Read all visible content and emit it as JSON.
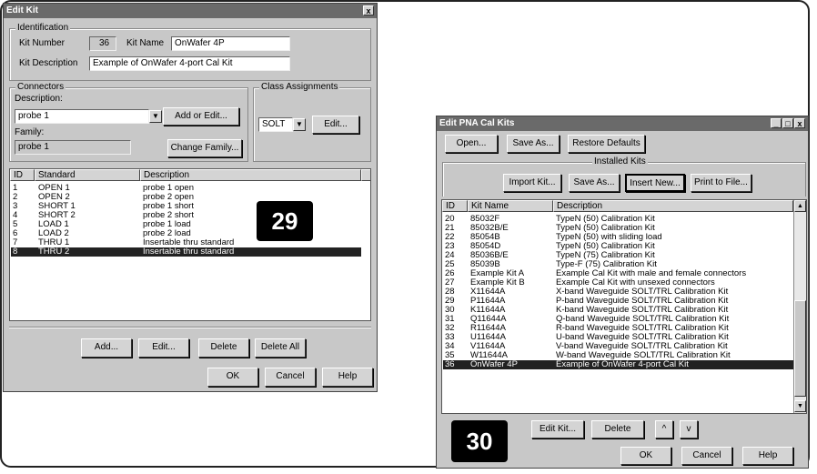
{
  "edit_kit": {
    "title": "Edit Kit",
    "close": "x",
    "identification": {
      "label": "Identification",
      "kit_number_label": "Kit Number",
      "kit_number": "36",
      "kit_name_label": "Kit Name",
      "kit_name": "OnWafer 4P",
      "kit_description_label": "Kit Description",
      "kit_description": "Example of OnWafer 4-port Cal Kit"
    },
    "connectors": {
      "label": "Connectors",
      "description_label": "Description:",
      "description": "probe 1",
      "add_or_edit": "Add or Edit...",
      "family_label": "Family:",
      "family": "probe 1",
      "change_family": "Change Family..."
    },
    "class_assignments": {
      "label": "Class Assignments",
      "value": "SOLT",
      "edit": "Edit..."
    },
    "table": {
      "headers": [
        "ID",
        "Standard",
        "Description"
      ],
      "rows": [
        {
          "id": "1",
          "standard": "OPEN 1",
          "description": "probe 1 open"
        },
        {
          "id": "2",
          "standard": "OPEN 2",
          "description": "probe 2 open"
        },
        {
          "id": "3",
          "standard": "SHORT 1",
          "description": "probe 1 short"
        },
        {
          "id": "4",
          "standard": "SHORT 2",
          "description": "probe 2 short"
        },
        {
          "id": "5",
          "standard": "LOAD 1",
          "description": "probe 1 load"
        },
        {
          "id": "6",
          "standard": "LOAD 2",
          "description": "probe 2 load"
        },
        {
          "id": "7",
          "standard": "THRU 1",
          "description": "Insertable thru standard"
        },
        {
          "id": "8",
          "standard": "THRU 2",
          "description": "Insertable thru standard"
        }
      ],
      "selected_index": 7
    },
    "buttons": {
      "add": "Add...",
      "edit": "Edit...",
      "delete": "Delete",
      "delete_all": "Delete All",
      "ok": "OK",
      "cancel": "Cancel",
      "help": "Help"
    }
  },
  "badge_29": "29",
  "badge_30": "30",
  "cal_kits": {
    "title": "Edit PNA Cal Kits",
    "title_buttons": [
      "_",
      "□",
      "x"
    ],
    "top_buttons": {
      "open": "Open...",
      "save_as": "Save As...",
      "restore_defaults": "Restore Defaults"
    },
    "installed_label": "Installed Kits",
    "kit_buttons": {
      "import": "Import Kit...",
      "save_as": "Save As...",
      "insert_new": "Insert New...",
      "print": "Print to File..."
    },
    "table": {
      "headers": [
        "ID",
        "Kit Name",
        "Description"
      ],
      "rows": [
        {
          "id": "20",
          "name": "85032F",
          "description": "TypeN (50) Calibration Kit"
        },
        {
          "id": "21",
          "name": "85032B/E",
          "description": "TypeN (50) Calibration Kit"
        },
        {
          "id": "22",
          "name": "85054B",
          "description": "TypeN (50) with sliding load"
        },
        {
          "id": "23",
          "name": "85054D",
          "description": "TypeN (50) Calibration Kit"
        },
        {
          "id": "24",
          "name": "85036B/E",
          "description": "TypeN (75) Calibration Kit"
        },
        {
          "id": "25",
          "name": "85039B",
          "description": "Type-F (75) Calibration Kit"
        },
        {
          "id": "26",
          "name": "Example Kit A",
          "description": "Example Cal Kit with male and female connectors"
        },
        {
          "id": "27",
          "name": "Example Kit B",
          "description": "Example Cal Kit with unsexed connectors"
        },
        {
          "id": "28",
          "name": "X11644A",
          "description": "X-band Waveguide SOLT/TRL Calibration Kit"
        },
        {
          "id": "29",
          "name": "P11644A",
          "description": "P-band Waveguide SOLT/TRL Calibration Kit"
        },
        {
          "id": "30",
          "name": "K11644A",
          "description": "K-band Waveguide SOLT/TRL Calibration Kit"
        },
        {
          "id": "31",
          "name": "Q11644A",
          "description": "Q-band Waveguide SOLT/TRL Calibration Kit"
        },
        {
          "id": "32",
          "name": "R11644A",
          "description": "R-band Waveguide SOLT/TRL Calibration Kit"
        },
        {
          "id": "33",
          "name": "U11644A",
          "description": "U-band Waveguide SOLT/TRL Calibration Kit"
        },
        {
          "id": "34",
          "name": "V11644A",
          "description": "V-band Waveguide SOLT/TRL Calibration Kit"
        },
        {
          "id": "35",
          "name": "W11644A",
          "description": "W-band Waveguide SOLT/TRL Calibration Kit"
        },
        {
          "id": "36",
          "name": "OnWafer 4P",
          "description": "Example of OnWafer 4-port Cal Kit"
        }
      ],
      "selected_index": 16
    },
    "bottom_buttons": {
      "edit_kit": "Edit Kit...",
      "delete": "Delete",
      "up": "^",
      "down": "v",
      "ok": "OK",
      "cancel": "Cancel",
      "help": "Help"
    }
  }
}
